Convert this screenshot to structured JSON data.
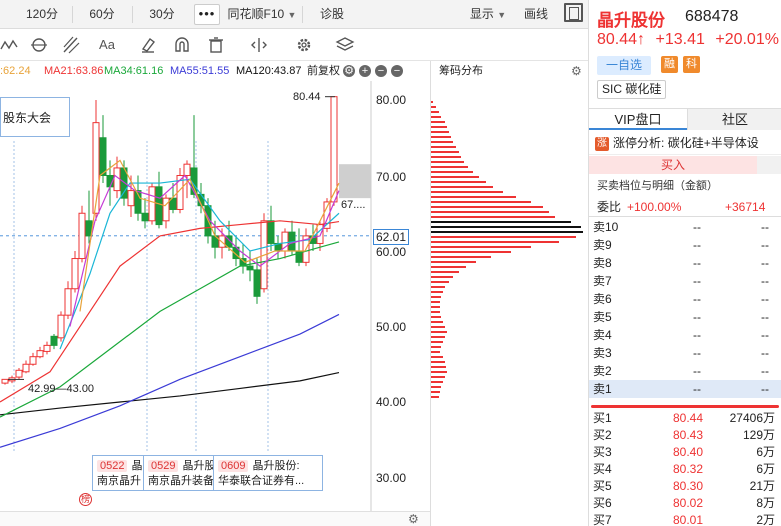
{
  "toolbar": {
    "periods": [
      "120分",
      "60分",
      "30分"
    ],
    "more_label": "•••",
    "f10_label": "同花顺F10",
    "diag_label": "诊股",
    "display_label": "显示",
    "draw_label": "画线"
  },
  "tools": [
    "wave-icon",
    "cycle-icon",
    "fork-icon",
    "text-icon",
    "eraser-icon",
    "magnet-icon",
    "trash-icon",
    "split-icon",
    "settings-icon",
    "layers-icon"
  ],
  "tool_text": "Aa",
  "legend": {
    "ma5": ":62.24",
    "ma21": "MA21:63.86",
    "ma34": "MA34:61.16",
    "ma55": "MA55:51.55",
    "ma120": "MA120:43.87",
    "adjust": "前复权",
    "colors": {
      "ma5": "#e8a33a",
      "ma21": "#e33",
      "ma34": "#1aa83a",
      "ma55": "#3b3bd6",
      "ma120": "#111"
    }
  },
  "chart": {
    "annotation": "股东大会",
    "high_label": "80.44",
    "low_label": "42.99—43.00",
    "target_label": "67....",
    "current_price_tag": "62.01",
    "y_axis": [
      "80.00",
      "70.00",
      "60.00",
      "50.00",
      "40.00",
      "30.00"
    ],
    "news": [
      {
        "date": "0522",
        "title": "晶",
        "sub": "南京晶升"
      },
      {
        "date": "0529",
        "title": "晶升股",
        "sub": "南京晶升装备"
      },
      {
        "date": "0609",
        "title": "晶升股份:",
        "sub": "华泰联合证券有..."
      }
    ],
    "bang_label": "榜",
    "colors": {
      "up": "#e33",
      "down": "#1a9a3a"
    }
  },
  "chip": {
    "title": "筹码分布"
  },
  "quote": {
    "name": "晶升股份",
    "code": "688478",
    "price": "80.44↑",
    "change": "+13.41",
    "pct": "+20.01%",
    "watch_label": "一自选",
    "tag_rong": "融",
    "tag_ke": "科",
    "concept": "SIC 碳化硅",
    "tabs": [
      "VIP盘口",
      "社区"
    ],
    "limit_label": "涨停分析:",
    "limit_text": "碳化硅+半导体设",
    "limit_icon": "涨",
    "buy_in": "买入",
    "depth_title": "买卖档位与明细（金额）",
    "webi_label": "委比",
    "webi_value": "+100.00%",
    "webi_diff": "+36714",
    "asks": [
      {
        "label": "卖10",
        "price": "--",
        "vol": "--"
      },
      {
        "label": "卖9",
        "price": "--",
        "vol": "--"
      },
      {
        "label": "卖8",
        "price": "--",
        "vol": "--"
      },
      {
        "label": "卖7",
        "price": "--",
        "vol": "--"
      },
      {
        "label": "卖6",
        "price": "--",
        "vol": "--"
      },
      {
        "label": "卖5",
        "price": "--",
        "vol": "--"
      },
      {
        "label": "卖4",
        "price": "--",
        "vol": "--"
      },
      {
        "label": "卖3",
        "price": "--",
        "vol": "--"
      },
      {
        "label": "卖2",
        "price": "--",
        "vol": "--"
      },
      {
        "label": "卖1",
        "price": "--",
        "vol": "--"
      }
    ],
    "bids": [
      {
        "label": "买1",
        "price": "80.44",
        "vol": "27406万"
      },
      {
        "label": "买2",
        "price": "80.43",
        "vol": "129万"
      },
      {
        "label": "买3",
        "price": "80.40",
        "vol": "6万"
      },
      {
        "label": "买4",
        "price": "80.32",
        "vol": "6万"
      },
      {
        "label": "买5",
        "price": "80.30",
        "vol": "21万"
      },
      {
        "label": "买6",
        "price": "80.02",
        "vol": "8万"
      },
      {
        "label": "买7",
        "price": "80.01",
        "vol": "2万"
      }
    ]
  }
}
